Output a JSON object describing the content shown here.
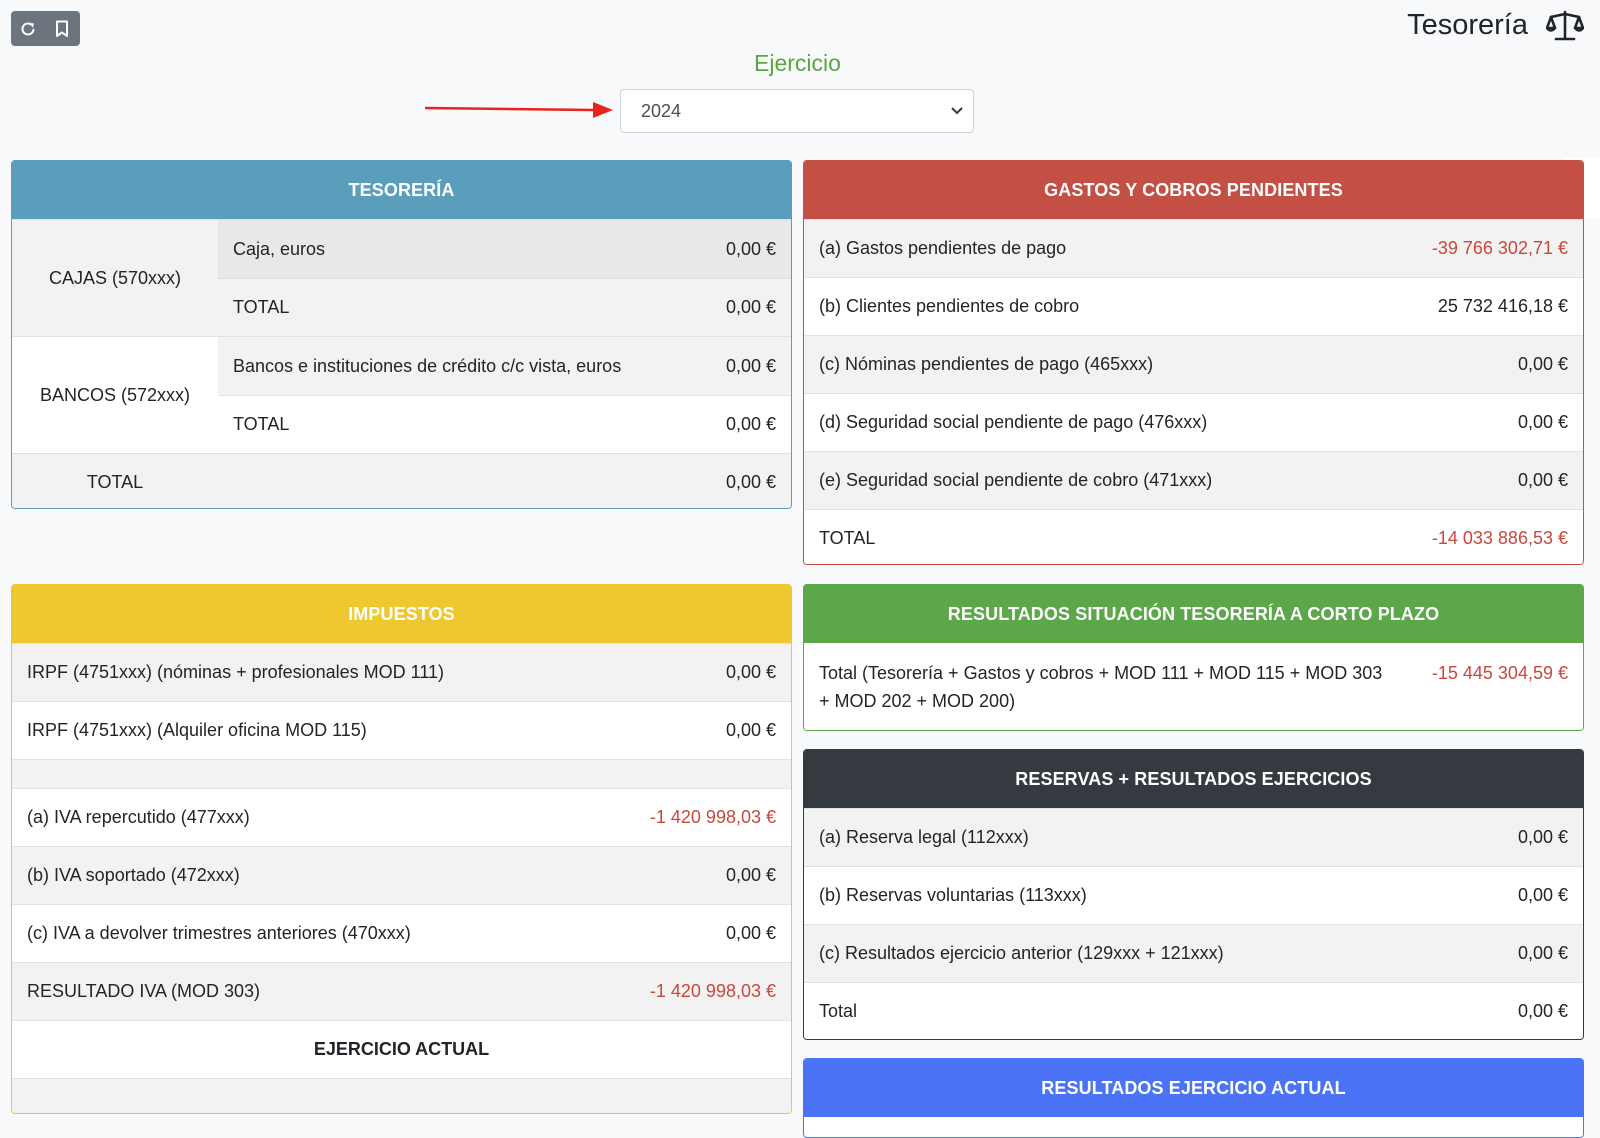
{
  "page": {
    "title": "Tesorería",
    "title_icon": "balance-scale-icon"
  },
  "toolbar": {
    "refresh_icon": "refresh-icon",
    "bookmark_icon": "bookmark-icon"
  },
  "ejercicio": {
    "label": "Ejercicio",
    "selected": "2024"
  },
  "tesoreria": {
    "header": "TESORERÍA",
    "cajas": {
      "label": "CAJAS (570xxx)",
      "rows": [
        {
          "label": "Caja, euros",
          "value": "0,00 €"
        },
        {
          "label": "TOTAL",
          "value": "0,00 €"
        }
      ]
    },
    "bancos": {
      "label": "BANCOS (572xxx)",
      "rows": [
        {
          "label": "Bancos e instituciones de crédito c/c vista, euros",
          "value": "0,00 €"
        },
        {
          "label": "TOTAL",
          "value": "0,00 €"
        }
      ]
    },
    "total": {
      "label": "TOTAL",
      "value": "0,00 €"
    },
    "color": "#5b9ebc"
  },
  "gastos": {
    "header": "GASTOS Y COBROS PENDIENTES",
    "color": "#c45045",
    "rows": [
      {
        "label": "(a) Gastos pendientes de pago",
        "value": "-39 766 302,71 €"
      },
      {
        "label": "(b) Clientes pendientes de cobro",
        "value": "25 732 416,18 €"
      },
      {
        "label": "(c) Nóminas pendientes de pago (465xxx)",
        "value": "0,00 €"
      },
      {
        "label": "(d) Seguridad social pendiente de pago (476xxx)",
        "value": "0,00 €"
      },
      {
        "label": "(e) Seguridad social pendiente de cobro (471xxx)",
        "value": "0,00 €"
      },
      {
        "label": "TOTAL",
        "value": "-14 033 886,53 €"
      }
    ]
  },
  "impuestos": {
    "header": "IMPUESTOS",
    "color": "#efc830",
    "rows_top": [
      {
        "label": "IRPF (4751xxx) (nóminas + profesionales MOD 111)",
        "value": "0,00 €"
      },
      {
        "label": "IRPF (4751xxx) (Alquiler oficina MOD 115)",
        "value": "0,00 €"
      }
    ],
    "rows_iva": [
      {
        "label": "(a) IVA repercutido (477xxx)",
        "value": "-1 420 998,03 €"
      },
      {
        "label": "(b) IVA soportado (472xxx)",
        "value": "0,00 €"
      },
      {
        "label": "(c) IVA a devolver trimestres anteriores (470xxx)",
        "value": "0,00 €"
      },
      {
        "label": "RESULTADO IVA (MOD 303)",
        "value": "-1 420 998,03 €"
      }
    ],
    "ejercicio_actual": "EJERCICIO ACTUAL"
  },
  "resultados_cp": {
    "header": "RESULTADOS SITUACIÓN TESORERÍA A CORTO PLAZO",
    "color": "#5ca74a",
    "label": "Total (Tesorería + Gastos y cobros + MOD 111 + MOD 115 + MOD 303 + MOD 202 + MOD 200)",
    "value": "-15 445 304,59 €"
  },
  "reservas": {
    "header": "RESERVAS + RESULTADOS EJERCICIOS",
    "color": "#343a40",
    "rows": [
      {
        "label": "(a) Reserva legal (112xxx)",
        "value": "0,00 €"
      },
      {
        "label": "(b) Reservas voluntarias (113xxx)",
        "value": "0,00 €"
      },
      {
        "label": "(c) Resultados ejercicio anterior (129xxx + 121xxx)",
        "value": "0,00 €"
      },
      {
        "label": "Total",
        "value": "0,00 €"
      }
    ]
  },
  "resultados_actual": {
    "header": "RESULTADOS EJERCICIO ACTUAL",
    "color": "#4a74f5"
  }
}
